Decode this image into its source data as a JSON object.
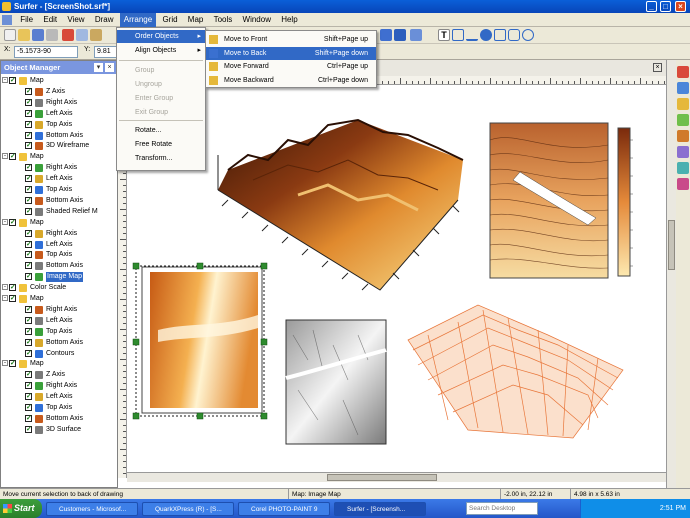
{
  "window": {
    "title": "Surfer - [ScreenShot.srf*]",
    "controls": [
      "_",
      "□",
      "×"
    ]
  },
  "menubar": [
    "File",
    "Edit",
    "View",
    "Draw",
    "Arrange",
    "Grid",
    "Map",
    "Tools",
    "Window",
    "Help"
  ],
  "toolbar": {
    "coord_x": "-5.1573-90",
    "coord_y": "9.81"
  },
  "object_manager": {
    "title": "Object Manager",
    "items": [
      {
        "label": "Map",
        "level": 0,
        "checked": true
      },
      {
        "label": "Z Axis",
        "level": 1,
        "checked": true
      },
      {
        "label": "Right Axis",
        "level": 1,
        "checked": true
      },
      {
        "label": "Left Axis",
        "level": 1,
        "checked": true
      },
      {
        "label": "Top Axis",
        "level": 1,
        "checked": true
      },
      {
        "label": "Bottom Axis",
        "level": 1,
        "checked": true
      },
      {
        "label": "3D Wireframe",
        "level": 1,
        "checked": true
      },
      {
        "label": "Map",
        "level": 0,
        "checked": true
      },
      {
        "label": "Right Axis",
        "level": 1,
        "checked": true
      },
      {
        "label": "Left Axis",
        "level": 1,
        "checked": true
      },
      {
        "label": "Top Axis",
        "level": 1,
        "checked": true
      },
      {
        "label": "Bottom Axis",
        "level": 1,
        "checked": true
      },
      {
        "label": "Shaded Relief M",
        "level": 1,
        "checked": true
      },
      {
        "label": "Map",
        "level": 0,
        "checked": true
      },
      {
        "label": "Right Axis",
        "level": 1,
        "checked": true
      },
      {
        "label": "Left Axis",
        "level": 1,
        "checked": true
      },
      {
        "label": "Top Axis",
        "level": 1,
        "checked": true
      },
      {
        "label": "Bottom Axis",
        "level": 1,
        "checked": true
      },
      {
        "label": "Image Map",
        "level": 1,
        "checked": true,
        "selected": true
      },
      {
        "label": "Color Scale",
        "level": 0,
        "checked": true
      },
      {
        "label": "Map",
        "level": 0,
        "checked": true
      },
      {
        "label": "Right Axis",
        "level": 1,
        "checked": true
      },
      {
        "label": "Left Axis",
        "level": 1,
        "checked": true
      },
      {
        "label": "Top Axis",
        "level": 1,
        "checked": true
      },
      {
        "label": "Bottom Axis",
        "level": 1,
        "checked": true
      },
      {
        "label": "Contours",
        "level": 1,
        "checked": true
      },
      {
        "label": "Map",
        "level": 0,
        "checked": true
      },
      {
        "label": "Z Axis",
        "level": 1,
        "checked": true
      },
      {
        "label": "Right Axis",
        "level": 1,
        "checked": true
      },
      {
        "label": "Left Axis",
        "level": 1,
        "checked": true
      },
      {
        "label": "Top Axis",
        "level": 1,
        "checked": true
      },
      {
        "label": "Bottom Axis",
        "level": 1,
        "checked": true
      },
      {
        "label": "3D Surface",
        "level": 1,
        "checked": true
      }
    ]
  },
  "arrange_menu": {
    "items": [
      {
        "label": "Order Objects",
        "state": "highlighted",
        "submenu": true
      },
      {
        "label": "Align Objects",
        "state": "normal",
        "submenu": true
      },
      {
        "label": "Group",
        "state": "disabled"
      },
      {
        "label": "Ungroup",
        "state": "disabled"
      },
      {
        "label": "Enter Group",
        "state": "disabled"
      },
      {
        "label": "Exit Group",
        "state": "disabled"
      },
      {
        "label": "Rotate...",
        "state": "normal"
      },
      {
        "label": "Free Rotate",
        "state": "normal"
      },
      {
        "label": "Transform...",
        "state": "normal"
      }
    ]
  },
  "order_submenu": {
    "items": [
      {
        "label": "Move to Front",
        "shortcut": "Shift+Page up",
        "state": "normal"
      },
      {
        "label": "Move to Back",
        "shortcut": "Shift+Page down",
        "state": "highlighted"
      },
      {
        "label": "Move Forward",
        "shortcut": "Ctrl+Page up",
        "state": "normal"
      },
      {
        "label": "Move Backward",
        "shortcut": "Ctrl+Page down",
        "state": "normal"
      }
    ]
  },
  "statusbar": {
    "message": "Move current selection to back of drawing",
    "object": "Map: Image Map",
    "position": "-2.00 in, 22.12 in",
    "size": "4.98 in x 5.63 in"
  },
  "taskbar": {
    "start": "Start",
    "tasks": [
      "Customers - Microsof...",
      "QuarkXPress (R) - [S...",
      "Corel PHOTO-PAINT 9",
      "Surfer - [Screensh..."
    ],
    "search_placeholder": "Search Desktop",
    "clock": "2:51 PM"
  },
  "colors": {
    "accent": "#3169c6",
    "relief_dark": "#5a2a10",
    "relief_light": "#f6d88a",
    "wire": "#e8763a"
  }
}
